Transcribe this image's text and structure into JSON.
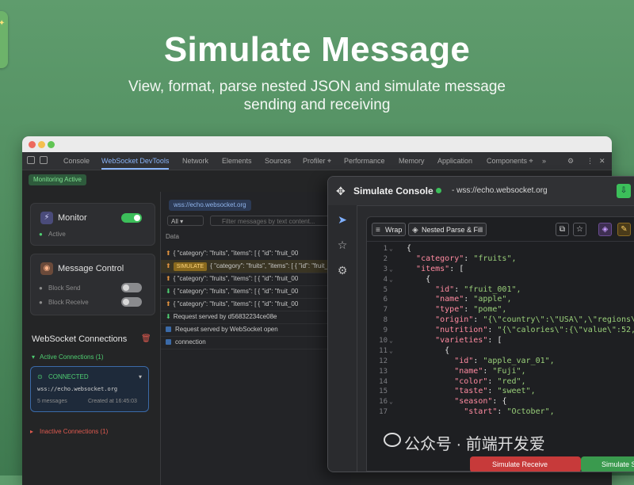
{
  "hero": {
    "title": "Simulate Message",
    "subtitle_line1": "View, format, parse nested JSON and simulate message",
    "subtitle_line2": "sending and receiving"
  },
  "devtools": {
    "tabs": [
      "Console",
      "WebSocket DevTools",
      "Network",
      "Elements",
      "Sources",
      "Profiler ⌖",
      "Performance",
      "Memory",
      "Application",
      "Components ⌖",
      "»"
    ],
    "active_tab": "WebSocket DevTools",
    "monitoring_badge": "Monitoring Active"
  },
  "monitor_card": {
    "title": "Monitor",
    "status": "Active"
  },
  "message_control": {
    "title": "Message Control",
    "block_send": "Block Send",
    "block_receive": "Block Receive"
  },
  "connections": {
    "title": "WebSocket Connections",
    "active_label": "Active Connections (1)",
    "status": "CONNECTED",
    "url": "wss://echo.websocket.org",
    "messages": "5 messages",
    "created": "Created at 16:45:03",
    "inactive_label": "Inactive Connections (1)"
  },
  "log": {
    "url": "wss://echo.websocket.org",
    "filter_select": "All",
    "filter_placeholder": "Filter messages by text content...",
    "data_header": "Data",
    "rows": [
      "{ \"category\": \"fruits\", \"items\": [ { \"id\": \"fruit_00",
      "{ \"category\": \"fruits\", \"items\": [ { \"id\": \"fruit_00",
      "{ \"category\": \"fruits\", \"items\": [ { \"id\": \"fruit_00",
      "{ \"category\": \"fruits\", \"items\": [ { \"id\": \"fruit_00",
      "{ \"category\": \"fruits\", \"items\": [ { \"id\": \"fruit_00",
      "Request served by d56832234ce08e",
      "Request served by WebSocket open",
      "connection"
    ],
    "simulate_tag": "SIMULATE"
  },
  "console": {
    "title": "Simulate Console",
    "url": "- wss://echo.websocket.org",
    "wrap_label": "Wrap",
    "nested_label": "Nested Parse & Fill",
    "simulate_receive": "Simulate Receive",
    "simulate_send": "Simulate Send",
    "code_lines": [
      "{",
      "  \"category\": \"fruits\",",
      "  \"items\": [",
      "    {",
      "      \"id\": \"fruit_001\",",
      "      \"name\": \"apple\",",
      "      \"type\": \"pome\",",
      "      \"origin\": \"{\\\"country\\\":\\\"USA\\\",\\\"regions\\\"",
      "      \"nutrition\": \"{\\\"calories\\\":{\\\"value\\\":52,",
      "      \"varieties\": [",
      "        {",
      "          \"id\": \"apple_var_01\",",
      "          \"name\": \"Fuji\",",
      "          \"color\": \"red\",",
      "          \"taste\": \"sweet\",",
      "          \"season\": {",
      "            \"start\": \"October\","
    ]
  },
  "watermark": "公众号 · 前端开发爱"
}
